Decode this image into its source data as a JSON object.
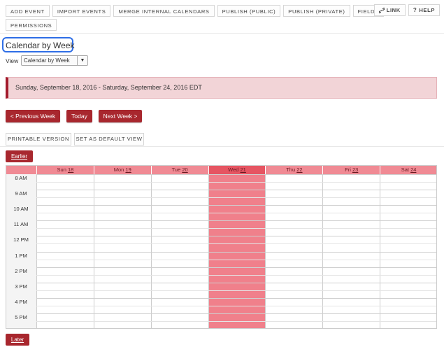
{
  "toolbar": {
    "row1": [
      "ADD EVENT",
      "IMPORT EVENTS",
      "MERGE INTERNAL CALENDARS",
      "PUBLISH (PUBLIC)",
      "PUBLISH (PRIVATE)",
      "FIELDS"
    ],
    "row2": [
      "PERMISSIONS"
    ],
    "link_label": "LINK",
    "help_label": "HELP",
    "link_icon": "link-icon",
    "help_icon": "question-icon"
  },
  "page": {
    "title": "Calendar by Week",
    "view_label": "View",
    "view_selected": "Calendar by Week"
  },
  "banner": {
    "date_range": "Sunday, September 18, 2016 - Saturday, September 24, 2016 EDT"
  },
  "nav": {
    "prev": "< Previous Week",
    "today": "Today",
    "next": "Next Week >",
    "printable": "PRINTABLE VERSION",
    "set_default": "SET AS DEFAULT VIEW",
    "earlier": "Earlier",
    "later": "Later"
  },
  "calendar": {
    "days": [
      {
        "name": "Sun",
        "num": "18"
      },
      {
        "name": "Mon",
        "num": "19"
      },
      {
        "name": "Tue",
        "num": "20"
      },
      {
        "name": "Wed",
        "num": "21"
      },
      {
        "name": "Thu",
        "num": "22"
      },
      {
        "name": "Fri",
        "num": "23"
      },
      {
        "name": "Sat",
        "num": "24"
      }
    ],
    "today_index": 3,
    "hours": [
      "8 AM",
      "9 AM",
      "10 AM",
      "11 AM",
      "12 PM",
      "1 PM",
      "2 PM",
      "3 PM",
      "4 PM",
      "5 PM"
    ]
  },
  "colors": {
    "accent": "#a8272e",
    "header": "#f08a94",
    "today": "#f0808b",
    "banner_bg": "#f2d4d7",
    "focus_ring": "#2e6ee6"
  }
}
